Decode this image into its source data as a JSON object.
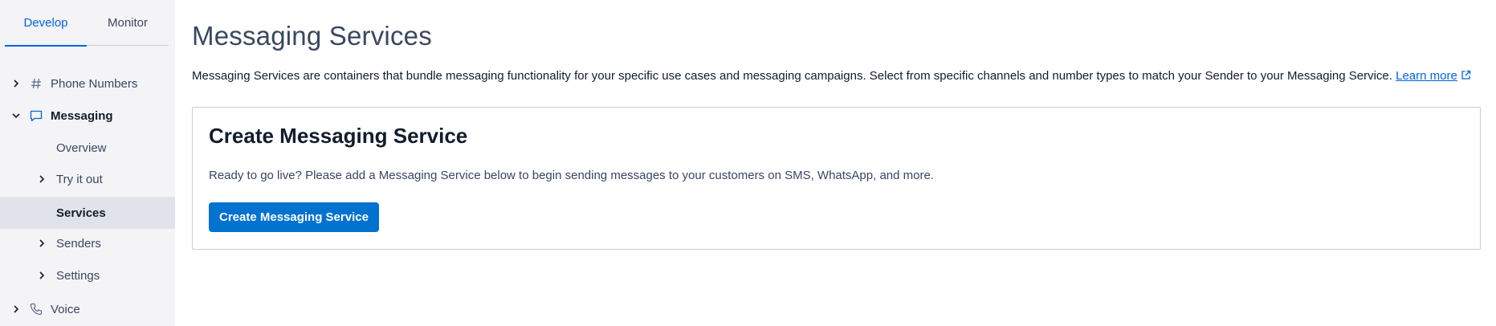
{
  "sidebar": {
    "tabs": [
      {
        "label": "Develop",
        "active": true
      },
      {
        "label": "Monitor",
        "active": false
      }
    ],
    "items": {
      "phone_numbers": {
        "label": "Phone Numbers",
        "icon": "hash-icon"
      },
      "messaging": {
        "label": "Messaging",
        "icon": "chat-bubble-icon",
        "expanded": true
      },
      "overview": {
        "label": "Overview"
      },
      "try_it_out": {
        "label": "Try it out"
      },
      "services": {
        "label": "Services",
        "selected": true
      },
      "senders": {
        "label": "Senders"
      },
      "settings": {
        "label": "Settings"
      },
      "voice": {
        "label": "Voice",
        "icon": "phone-icon"
      }
    }
  },
  "main": {
    "title": "Messaging Services",
    "description": "Messaging Services are containers that bundle messaging functionality for your specific use cases and messaging campaigns. Select from specific channels and number types to match your Sender to your Messaging Service.",
    "learn_more": "Learn more",
    "card": {
      "title": "Create Messaging Service",
      "text": "Ready to go live? Please add a Messaging Service below to begin sending messages to your customers on SMS, WhatsApp, and more.",
      "button": "Create Messaging Service"
    }
  },
  "colors": {
    "accent": "#0263e0",
    "button": "#0272d1",
    "sidebar_bg": "#f4f4f6",
    "selected_bg": "#e1e3ea"
  }
}
